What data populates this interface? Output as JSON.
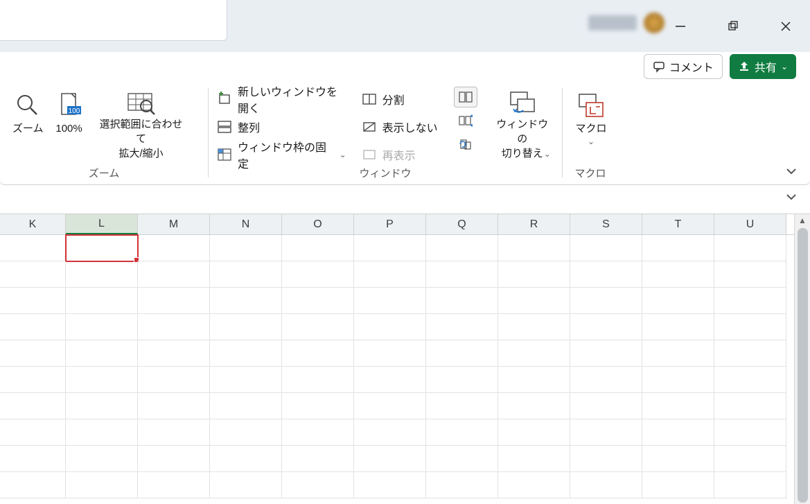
{
  "titlebar": {
    "comment_label": "コメント",
    "share_label": "共有"
  },
  "ribbon": {
    "zoom_group": {
      "zoom_label": "ズーム",
      "hundred_label": "100%",
      "fit_selection_label": "選択範囲に合わせて\n拡大/縮小",
      "group_title": "ズーム"
    },
    "window_group": {
      "new_window_label": "新しいウィンドウを開く",
      "arrange_label": "整列",
      "freeze_panes_label": "ウィンドウ枠の固定",
      "split_label": "分割",
      "hide_label": "表示しない",
      "unhide_label": "再表示",
      "switch_windows_label": "ウィンドウの\n切り替え",
      "group_title": "ウィンドウ"
    },
    "macro_group": {
      "macro_label": "マクロ",
      "group_title": "マクロ"
    }
  },
  "grid": {
    "columns": [
      "K",
      "L",
      "M",
      "N",
      "O",
      "P",
      "Q",
      "R",
      "S",
      "T",
      "U"
    ],
    "selected_column": "L",
    "selected_cell": "L1",
    "row_count": 10
  }
}
